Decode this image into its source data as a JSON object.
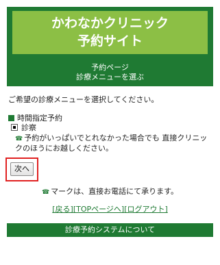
{
  "header": {
    "title_line1": "かわなかクリニック",
    "title_line2": "予約サイト",
    "sub_line1": "予約ページ",
    "sub_line2": "診療メニューを選ぶ"
  },
  "intro_text": "ご希望の診療メニューを選択してください。",
  "section": {
    "label": "時間指定予約"
  },
  "menu_option": {
    "label": "診察",
    "selected": true
  },
  "notice": {
    "text": "予約がいっぱいでとれなかった場合でも 直接クリニックのほうにお越しください。"
  },
  "next_button": {
    "label": "次へ"
  },
  "phone_note": {
    "text": "マークは、直接お電話にて承ります。"
  },
  "links": {
    "back": "[戻る]",
    "top": "[TOPページへ]",
    "logout": "[ログアウト]"
  },
  "footer": {
    "label": "診療予約システムについて"
  },
  "colors": {
    "brand_green": "#1f7a33",
    "title_green": "#8cbf45",
    "highlight_red": "#e02020"
  },
  "icons": {
    "section_marker": "square-icon",
    "phone": "phone-icon"
  }
}
